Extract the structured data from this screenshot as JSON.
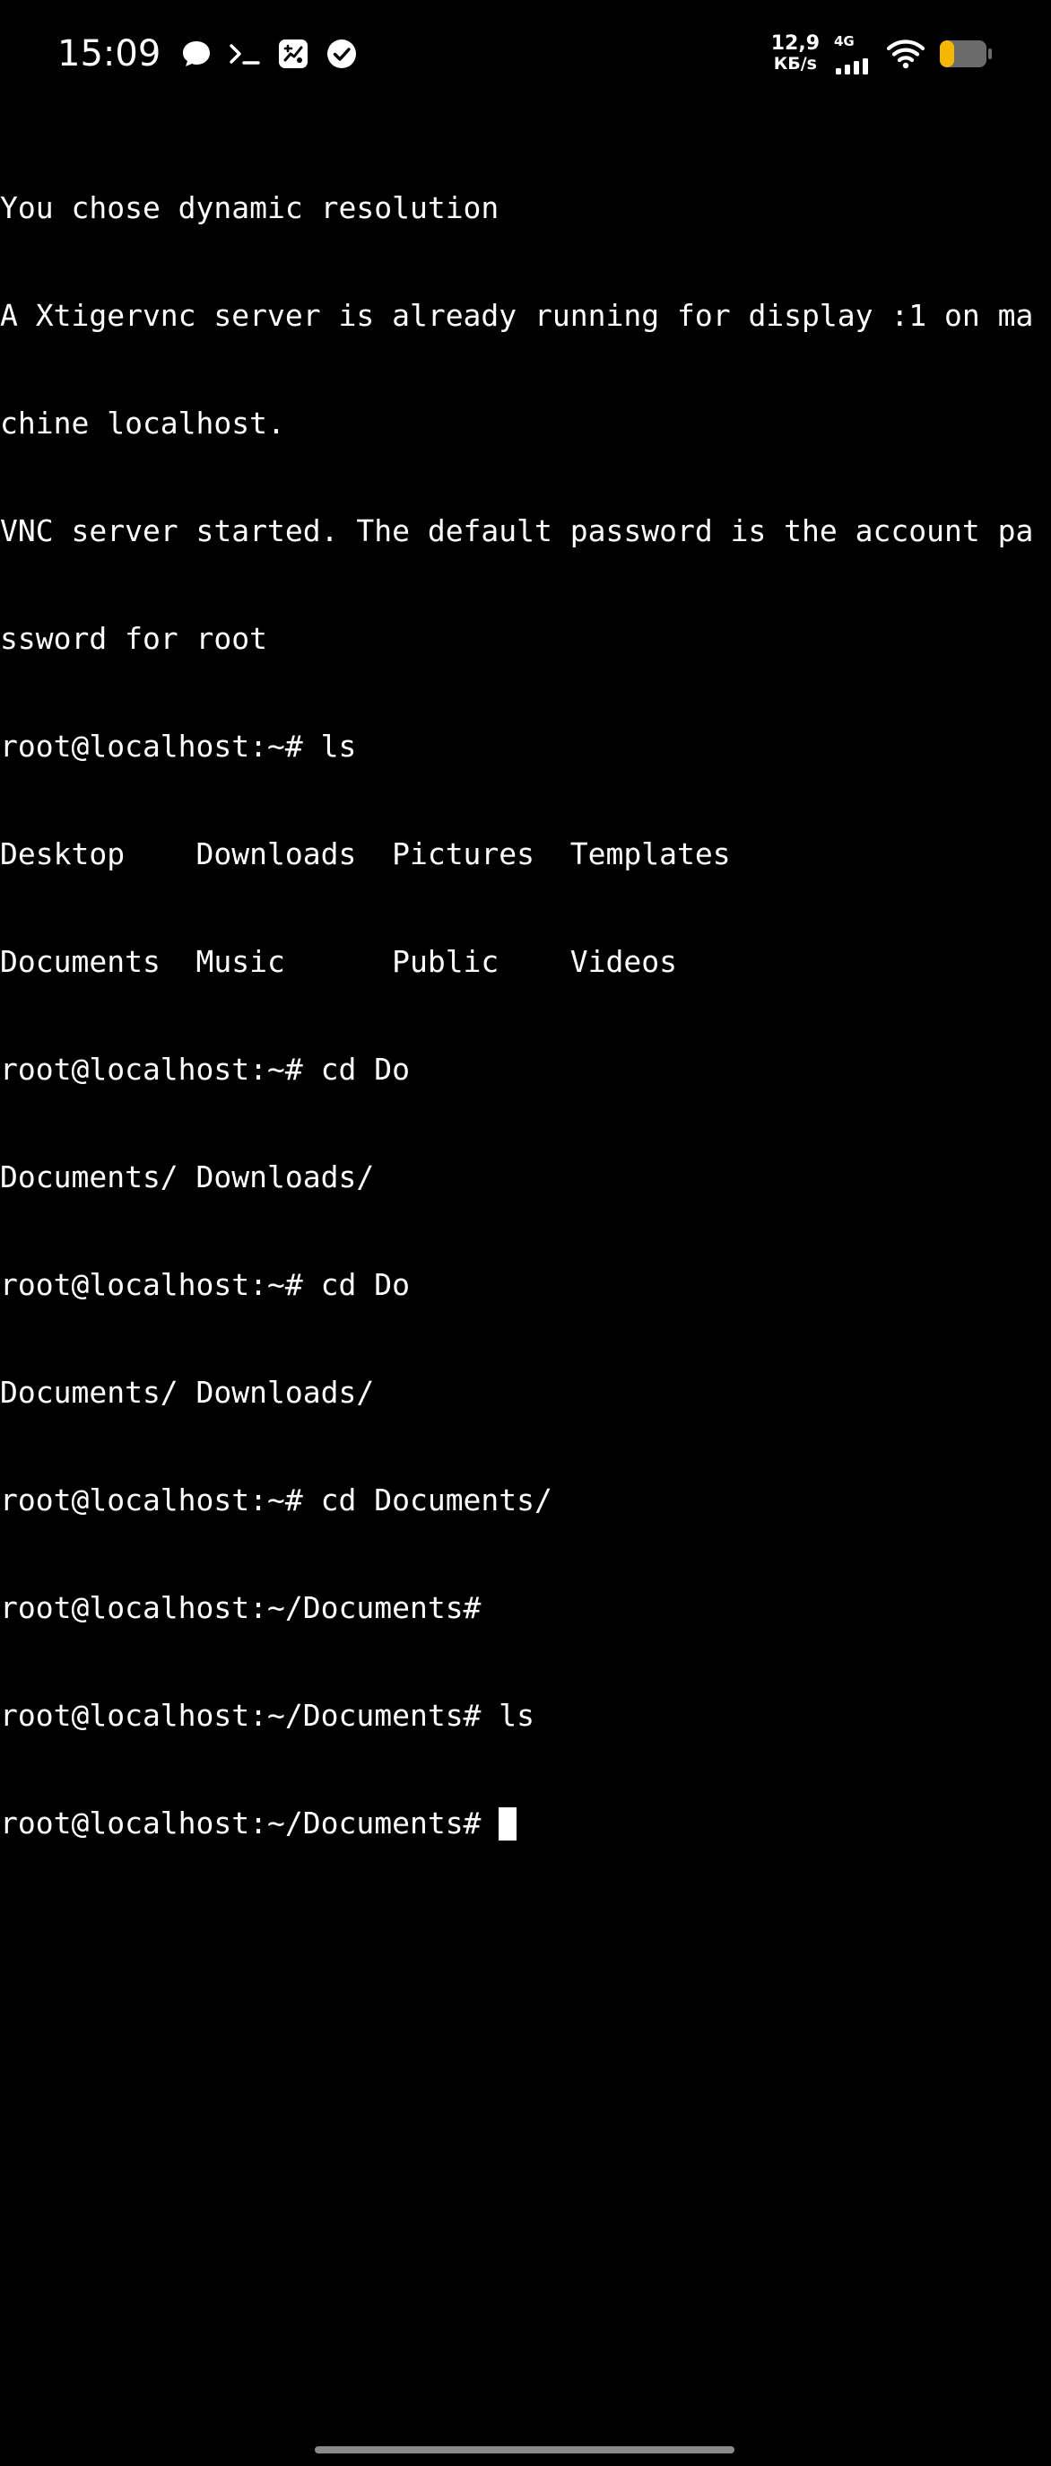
{
  "status_bar": {
    "time": "15:09",
    "icons": [
      "chat-bubble-icon",
      "terminal-prompt-icon",
      "app-notification-icon",
      "check-circle-icon"
    ],
    "net_speed_value": "12,9",
    "net_speed_unit": "КБ/s",
    "network_type": "4G",
    "signal_icon": "cellular-signal-icon",
    "wifi_icon": "wifi-icon",
    "battery_icon": "battery-icon",
    "battery_level": 0.3,
    "battery_color": "#f5b800"
  },
  "terminal": {
    "lines": [
      "You chose dynamic resolution",
      "A Xtigervnc server is already running for display :1 on ma",
      "chine localhost.",
      "VNC server started. The default password is the account pa",
      "ssword for root",
      "root@localhost:~# ls",
      "Desktop    Downloads  Pictures  Templates",
      "Documents  Music      Public    Videos",
      "root@localhost:~# cd Do",
      "Documents/ Downloads/",
      "root@localhost:~# cd Do",
      "Documents/ Downloads/",
      "root@localhost:~# cd Documents/",
      "root@localhost:~/Documents#",
      "root@localhost:~/Documents# ls"
    ],
    "prompt": "root@localhost:~/Documents# ",
    "background_color": "#000000",
    "text_color": "#ffffff"
  }
}
